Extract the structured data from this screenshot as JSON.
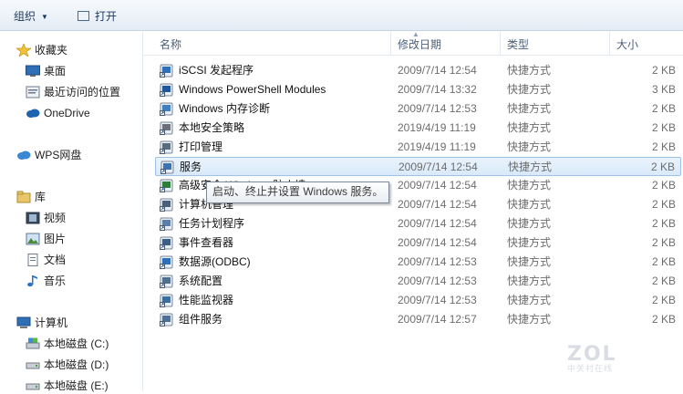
{
  "toolbar": {
    "organize_label": "组织",
    "open_label": "打开"
  },
  "nav": {
    "favorites_label": "收藏夹",
    "desktop_label": "桌面",
    "recent_label": "最近访问的位置",
    "onedrive_label": "OneDrive",
    "wps_label": "WPS网盘",
    "library_label": "库",
    "video_label": "视频",
    "pictures_label": "图片",
    "docs_label": "文档",
    "music_label": "音乐",
    "computer_label": "计算机",
    "drive_c": "本地磁盘 (C:)",
    "drive_d": "本地磁盘 (D:)",
    "drive_e": "本地磁盘 (E:)"
  },
  "columns": {
    "name": "名称",
    "date": "修改日期",
    "type": "类型",
    "size": "大小"
  },
  "files": [
    {
      "name": "iSCSI 发起程序",
      "date": "2009/7/14 12:54",
      "type": "快捷方式",
      "size": "2 KB",
      "icon": "iscsi-icon"
    },
    {
      "name": "Windows PowerShell Modules",
      "date": "2009/7/14 13:32",
      "type": "快捷方式",
      "size": "3 KB",
      "icon": "powershell-icon"
    },
    {
      "name": "Windows 内存诊断",
      "date": "2009/7/14 12:53",
      "type": "快捷方式",
      "size": "2 KB",
      "icon": "memory-diagnostic-icon"
    },
    {
      "name": "本地安全策略",
      "date": "2019/4/19 11:19",
      "type": "快捷方式",
      "size": "2 KB",
      "icon": "security-policy-icon"
    },
    {
      "name": "打印管理",
      "date": "2019/4/19 11:19",
      "type": "快捷方式",
      "size": "2 KB",
      "icon": "print-management-icon"
    },
    {
      "name": "服务",
      "date": "2009/7/14 12:54",
      "type": "快捷方式",
      "size": "2 KB",
      "icon": "services-icon"
    },
    {
      "name": "高级安全 Windows 防火墙",
      "date": "2009/7/14 12:54",
      "type": "快捷方式",
      "size": "2 KB",
      "icon": "firewall-icon"
    },
    {
      "name": "计算机管理",
      "date": "2009/7/14 12:54",
      "type": "快捷方式",
      "size": "2 KB",
      "icon": "computer-management-icon"
    },
    {
      "name": "任务计划程序",
      "date": "2009/7/14 12:54",
      "type": "快捷方式",
      "size": "2 KB",
      "icon": "task-scheduler-icon"
    },
    {
      "name": "事件查看器",
      "date": "2009/7/14 12:54",
      "type": "快捷方式",
      "size": "2 KB",
      "icon": "event-viewer-icon"
    },
    {
      "name": "数据源(ODBC)",
      "date": "2009/7/14 12:53",
      "type": "快捷方式",
      "size": "2 KB",
      "icon": "odbc-icon"
    },
    {
      "name": "系统配置",
      "date": "2009/7/14 12:53",
      "type": "快捷方式",
      "size": "2 KB",
      "icon": "system-config-icon"
    },
    {
      "name": "性能监视器",
      "date": "2009/7/14 12:53",
      "type": "快捷方式",
      "size": "2 KB",
      "icon": "performance-monitor-icon"
    },
    {
      "name": "组件服务",
      "date": "2009/7/14 12:57",
      "type": "快捷方式",
      "size": "2 KB",
      "icon": "component-services-icon"
    }
  ],
  "selected_index": 5,
  "tooltip": "启动、终止并设置 Windows 服务。",
  "watermark": {
    "brand": "ZOL",
    "sub": "中关村在线"
  }
}
